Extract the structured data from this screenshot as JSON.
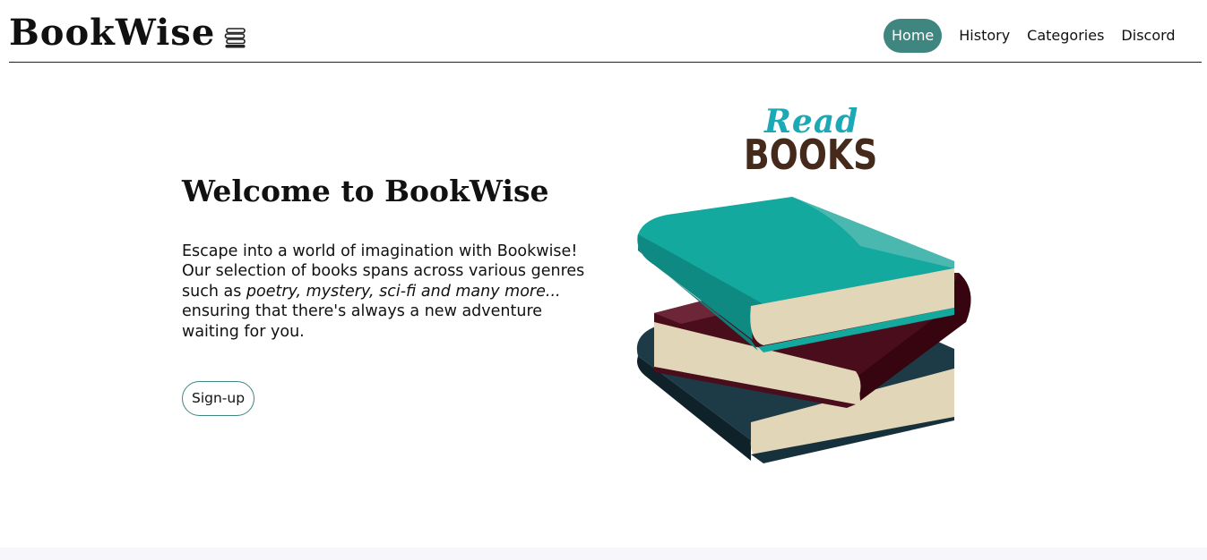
{
  "header": {
    "brand": "BookWise",
    "brand_icon": "stacked-books-icon",
    "nav": [
      {
        "label": "Home",
        "active": true
      },
      {
        "label": "History",
        "active": false
      },
      {
        "label": "Categories",
        "active": false
      },
      {
        "label": "Discord",
        "active": false
      }
    ]
  },
  "hero": {
    "title": "Welcome to BookWise",
    "lines": {
      "l1": "Escape into a world of imagination with Bookwise!",
      "l2": "Our selection of books spans across various genres",
      "l3_prefix": "such as ",
      "l3_italic": "poetry, mystery, sci-fi and many more...",
      "l4": "ensuring that there's always a new adventure",
      "l5": "waiting for you."
    },
    "signup_label": "Sign-up"
  },
  "illustration": {
    "read_word": "Read",
    "books_word": "BOOKS"
  },
  "colors": {
    "accent": "#3f8580",
    "teal_book": "#14a99e",
    "maroon_book": "#4a0d1c",
    "navy_book": "#16313b",
    "pages": "#e2d6b9",
    "read_text": "#1ba9b8",
    "books_text": "#45291a"
  }
}
